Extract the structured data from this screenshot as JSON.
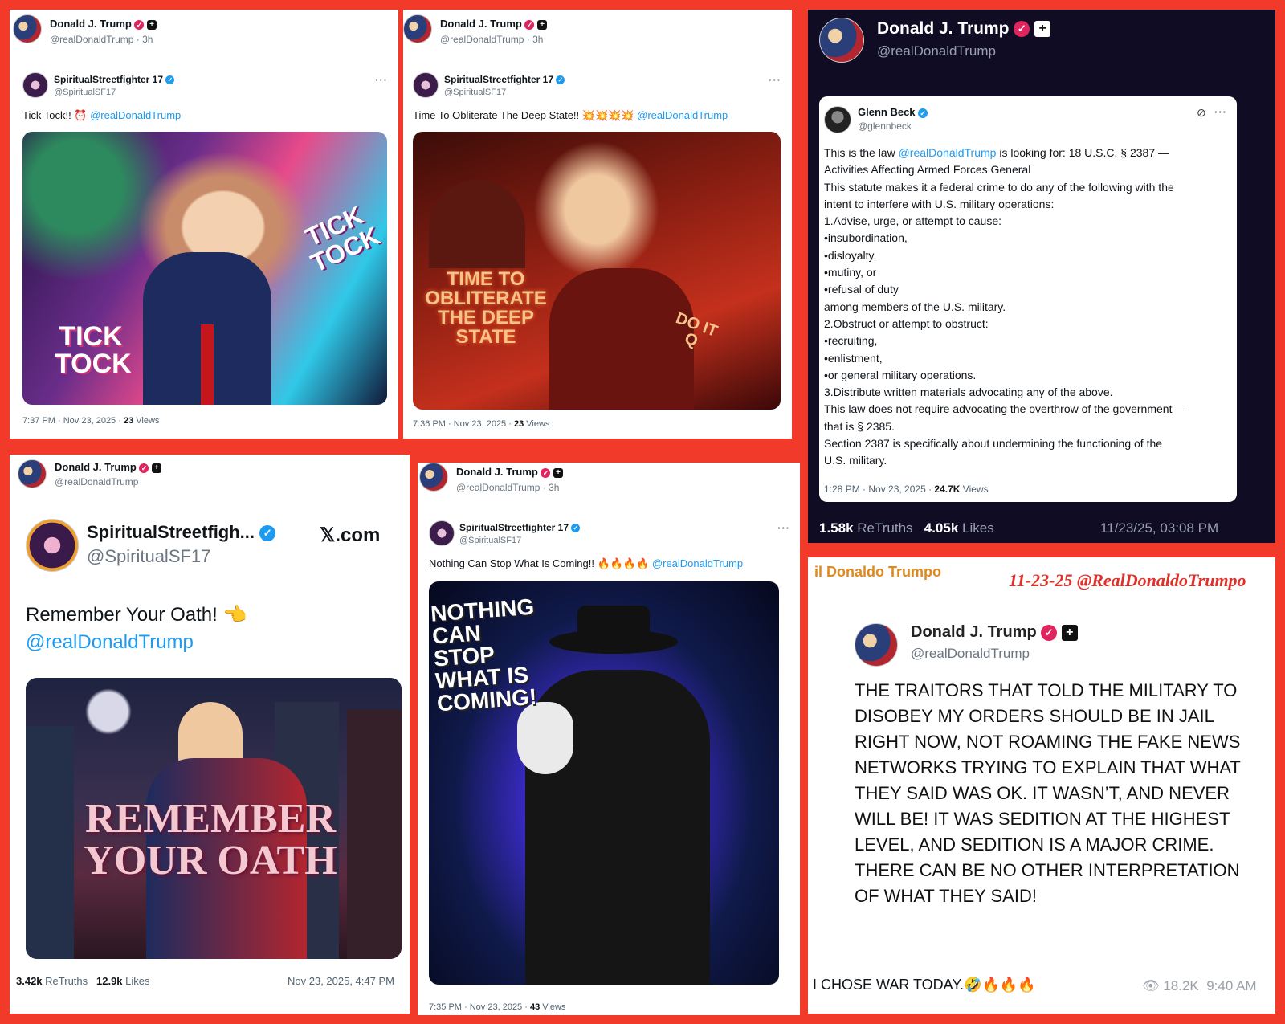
{
  "p1": {
    "author": "Donald J. Trump",
    "handle": "@realDonaldTrump · 3h",
    "q_name": "SpiritualStreetfighter 17",
    "q_handle": "@SpiritualSF17",
    "text": "Tick Tock!! ⏰",
    "mention": "@realDonaldTrump",
    "img_text_a": "TICK TOCK",
    "img_text_b": "TICK TOCK",
    "time": "7:37 PM · Nov 23, 2025 ·",
    "views": "23",
    "views_label": "Views"
  },
  "p2": {
    "author": "Donald J. Trump",
    "handle": "@realDonaldTrump · 3h",
    "q_name": "SpiritualStreetfighter 17",
    "q_handle": "@SpiritualSF17",
    "text": "Time To Obliterate The Deep State!! 💥💥💥💥",
    "mention": "@realDonaldTrump",
    "img_text": "TIME TO OBLITERATE THE DEEP STATE",
    "img_text_b": "DO IT Q",
    "time": "7:36 PM · Nov 23, 2025 ·",
    "views": "23",
    "views_label": "Views"
  },
  "p3": {
    "author": "Donald J. Trump",
    "handle": "@realDonaldTrump",
    "q_name": "Glenn Beck",
    "q_handle": "@glennbeck",
    "lines": [
      "Activities Affecting Armed Forces General",
      "This statute makes it a federal crime to do any of the following with the",
      "intent to interfere with U.S. military operations:",
      "1.Advise, urge, or attempt to cause:",
      "•insubordination,",
      "•disloyalty,",
      "•mutiny, or",
      "•refusal of duty",
      "among members of the U.S. military.",
      "2.Obstruct or attempt to obstruct:",
      "•recruiting,",
      "•enlistment,",
      "•or general military operations.",
      "3.Distribute written materials advocating any of the above.",
      "This law does not require advocating the overthrow of the government —",
      "that is § 2385.",
      "Section 2387 is specifically about undermining the functioning of the",
      "U.S. military."
    ],
    "line0_pre": "This is the law ",
    "line0_mention": "@realDonaldTrump",
    "line0_post": " is looking for:  18 U.S.C. § 2387 —",
    "time": "1:28 PM · Nov 23, 2025 ·",
    "views": "24.7K",
    "views_label": "Views",
    "retruths": "1.58k",
    "retruths_label": "ReTruths",
    "likes": "4.05k",
    "likes_label": "Likes",
    "date": "11/23/25, 03:08 PM"
  },
  "p4": {
    "author": "Donald J. Trump",
    "handle": "@realDonaldTrump",
    "q_name": "SpiritualStreetfigh...",
    "q_handle": "@SpiritualSF17",
    "xcom": "𝕏.com",
    "text": "Remember Your Oath! 👈",
    "mention": "@realDonaldTrump",
    "img_text": "REMEMBER YOUR OATH",
    "retruths": "3.42k",
    "retruths_label": "ReTruths",
    "likes": "12.9k",
    "likes_label": "Likes",
    "date": "Nov 23, 2025, 4:47 PM"
  },
  "p5": {
    "author": "Donald J. Trump",
    "handle": "@realDonaldTrump · 3h",
    "q_name": "SpiritualStreetfighter 17",
    "q_handle": "@SpiritualSF17",
    "text": "Nothing Can Stop What Is Coming!! 🔥🔥🔥🔥",
    "mention": "@realDonaldTrump",
    "img_text": "NOTHING CAN STOP WHAT IS COMING!",
    "time": "7:35 PM · Nov 23, 2025 ·",
    "views": "43",
    "views_label": "Views"
  },
  "p6": {
    "channel": "il Donaldo Trumpo",
    "stamp": "11-23-25 @RealDonaldoTrumpo",
    "author": "Donald J. Trump",
    "handle": "@realDonaldTrump",
    "body": "THE TRAITORS THAT TOLD THE MILITARY TO DISOBEY MY ORDERS SHOULD BE IN JAIL RIGHT NOW, NOT ROAMING THE FAKE NEWS NETWORKS TRYING TO EXPLAIN THAT WHAT THEY SAID WAS OK. IT WASN’T, AND NEVER WILL BE! IT WAS SEDITION AT THE HIGHEST LEVEL, AND SEDITION IS A MAJOR CRIME. THERE CAN BE NO OTHER INTERPRETATION OF WHAT THEY SAID!",
    "caption": "I CHOSE WAR TODAY.🤣🔥🔥🔥",
    "views": "18.2K",
    "time": "9:40 AM"
  }
}
